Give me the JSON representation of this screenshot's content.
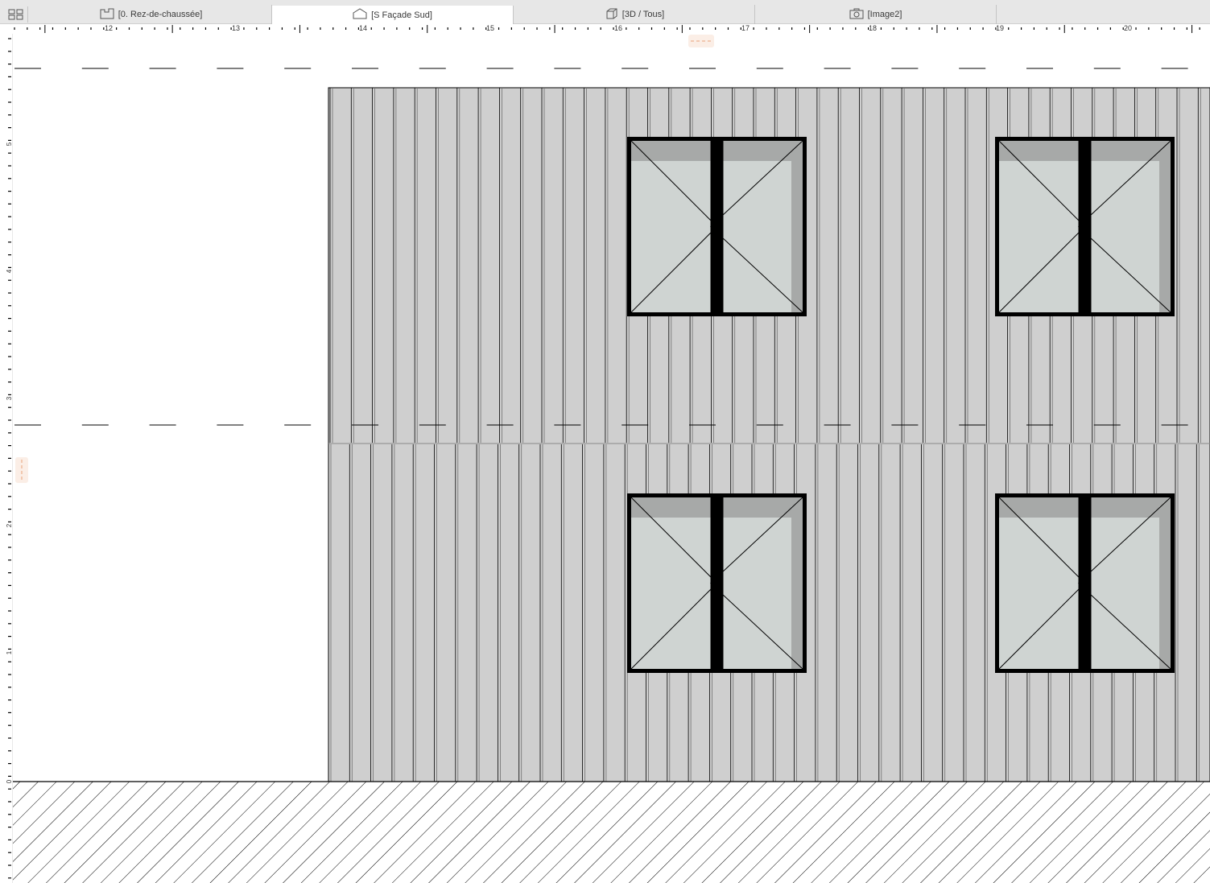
{
  "tabs": [
    {
      "icon": "floor-plan-icon",
      "label": "[0. Rez-de-chaussée]",
      "active": false
    },
    {
      "icon": "elevation-icon",
      "label": "[S Façade Sud]",
      "active": true
    },
    {
      "icon": "3d-view-icon",
      "label": "[3D / Tous]",
      "active": false
    },
    {
      "icon": "camera-icon",
      "label": "[Image2]",
      "active": false
    }
  ],
  "ruler_top": {
    "labels": [
      "12",
      "13",
      "14",
      "15",
      "16",
      "17",
      "18",
      "19",
      "20"
    ]
  },
  "ruler_left": {
    "labels": [
      "5",
      "4",
      "3",
      "2",
      "1",
      "0"
    ]
  },
  "colors": {
    "cladding": "#cfcfcf",
    "glass": "#cfd4d2",
    "glass_shade": "#a7a9a8",
    "frame": "#000000",
    "marker": "#e8a27a"
  }
}
